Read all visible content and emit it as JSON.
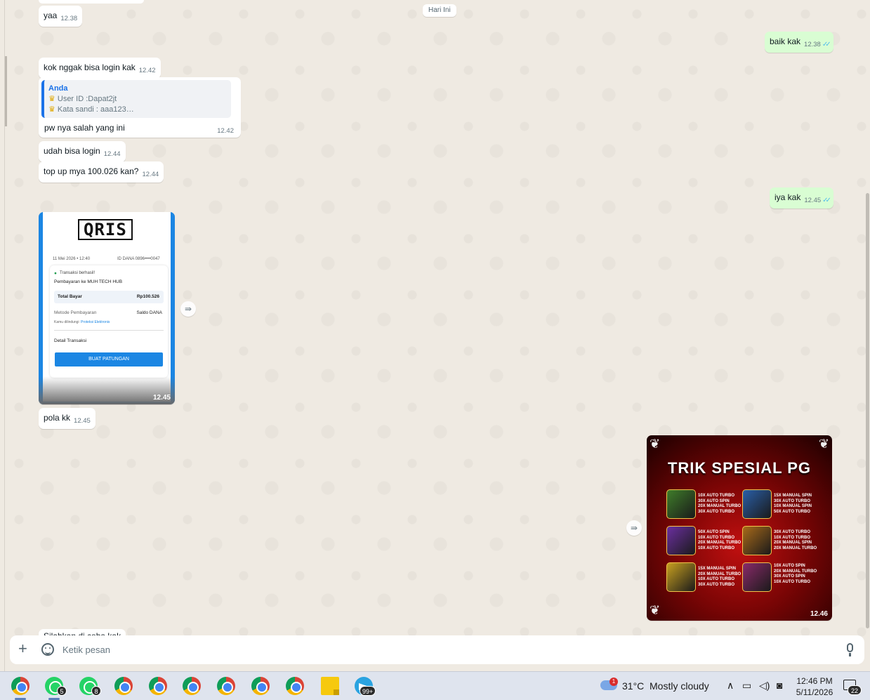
{
  "chat": {
    "date_chip": "Hari Ini",
    "messages": [
      {
        "text": "yaa",
        "time": "12.38"
      },
      {
        "text": "baik kak",
        "time": "12.38"
      },
      {
        "text": "kok nggak bisa login kak",
        "time": "12.42"
      },
      {
        "quote_author": "Anda",
        "quote_line1": "User ID :Dapat2jt",
        "quote_line2": "Kata sandi : aaa123…",
        "text": "pw nya salah  yang ini",
        "time": "12.42"
      },
      {
        "text": "udah bisa login",
        "time": "12.44"
      },
      {
        "text": "top up mya 100.026 kan?",
        "time": "12.44"
      },
      {
        "text": "iya kak",
        "time": "12.45"
      },
      {
        "text": "pola kk",
        "time": "12.45"
      }
    ],
    "receipt_image": {
      "time": "12.45",
      "logo": "QRIS",
      "date": "11 Mei 2026 • 12:40",
      "account": "ID DANA 0896••••0047",
      "status": "Transaksi berhasil!",
      "payee": "Pembayaran ke MUH TECH HUB",
      "total_label": "Total Bayar",
      "total_value": "Rp100.526",
      "method_label": "Metode Pembayaran",
      "method_value": "Saldo DANA",
      "protect_text": "Kamu dilindungi",
      "protect_link": "Proteksi Elektronis",
      "detail_label": "Detail Transaksi",
      "button_label": "BUAT PATUNGAN"
    },
    "promo_image": {
      "time": "12.46",
      "title": "TRIK SPESIAL PG",
      "games": [
        {
          "lines": [
            "10X AUTO TURBO",
            "30X AUTO SPIN",
            "20X MANUAL TURBO",
            "30X AUTO TURBO"
          ],
          "color": "#3f7d2a"
        },
        {
          "lines": [
            "15X MANUAL SPIN",
            "30X AUTO TURBO",
            "10X MANUAL SPIN",
            "50X AUTO TURBO"
          ],
          "color": "#2a5fa8"
        },
        {
          "lines": [
            "50X AUTO SPIN",
            "10X AUTO TURBO",
            "20X MANUAL TURBO",
            "10X AUTO TURBO"
          ],
          "color": "#6b2fa0"
        },
        {
          "lines": [
            "30X AUTO TURBO",
            "10X AUTO TURBO",
            "20X MANUAL SPIN",
            "20X MANUAL TURBO"
          ],
          "color": "#a86a1a"
        },
        {
          "lines": [
            "15X MANUAL SPIN",
            "20X MANUAL TURBO",
            "10X AUTO TURBO",
            "30X AUTO TURBO"
          ],
          "color": "#c8a020"
        },
        {
          "lines": [
            "10X AUTO SPIN",
            "20X MANUAL TURBO",
            "30X AUTO SPIN",
            "10X AUTO TURBO"
          ],
          "color": "#8a2a6a"
        }
      ]
    },
    "partial_message": "Silahkan di coba kak"
  },
  "input": {
    "placeholder": "Ketik pesan"
  },
  "taskbar": {
    "whatsapp_badge_1": "5",
    "whatsapp_badge_2": "8",
    "telegram_badge": "99+",
    "weather_badge": "1",
    "temperature": "31°C",
    "weather": "Mostly cloudy",
    "time": "12:46 PM",
    "date": "5/11/2026",
    "notification_count": "22"
  }
}
